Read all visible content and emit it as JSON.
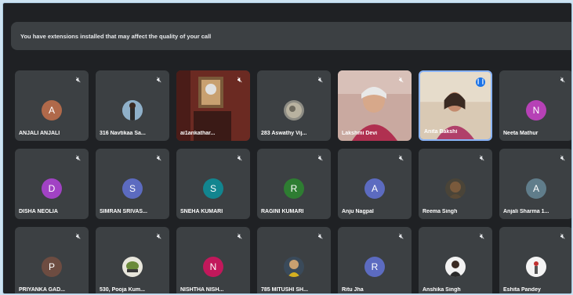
{
  "banner": {
    "text": "You have extensions installed that may affect the quality of your call"
  },
  "icons": {
    "mic_off": "mic-off-icon",
    "speaking": "speaking-indicator-icon"
  },
  "colors": {
    "speaking": "#1a73e8",
    "active_border": "#8ab4f8"
  },
  "participants": [
    {
      "name": "ANJALI ANJALI",
      "initial": "A",
      "color": "#b0694a"
    },
    {
      "name": "316 Navtikaa Sa...",
      "initial": "",
      "color": ""
    },
    {
      "name": "ai1ankathar...",
      "initial": "",
      "color": ""
    },
    {
      "name": "283 Aswathy Vij...",
      "initial": "",
      "color": ""
    },
    {
      "name": "Lakshmi Devi",
      "initial": "",
      "color": ""
    },
    {
      "name": "Anita Bakshi",
      "initial": "",
      "color": ""
    },
    {
      "name": "Neeta Mathur",
      "initial": "N",
      "color": "#b641b6"
    },
    {
      "name": "DISHA NEOLIA",
      "initial": "D",
      "color": "#a142c4"
    },
    {
      "name": "SIMRAN SRIVAS...",
      "initial": "S",
      "color": "#5c6bc0"
    },
    {
      "name": "SNEHA KUMARI",
      "initial": "S",
      "color": "#12858f"
    },
    {
      "name": "RAGINI KUMARI",
      "initial": "R",
      "color": "#2e7d32"
    },
    {
      "name": "Anju Nagpal",
      "initial": "A",
      "color": "#5c6bc0"
    },
    {
      "name": "Reema Singh",
      "initial": "",
      "color": ""
    },
    {
      "name": "Anjali Sharma 1...",
      "initial": "A",
      "color": "#607d8b"
    },
    {
      "name": "PRIYANKA GAD...",
      "initial": "P",
      "color": "#6d4c41"
    },
    {
      "name": "530, Pooja Kum...",
      "initial": "",
      "color": ""
    },
    {
      "name": "NISHTHA NISH...",
      "initial": "N",
      "color": "#c2185b"
    },
    {
      "name": "785 MITUSHI SH...",
      "initial": "",
      "color": ""
    },
    {
      "name": "Ritu Jha",
      "initial": "R",
      "color": "#5c6bc0"
    },
    {
      "name": "Anshika Singh",
      "initial": "",
      "color": ""
    },
    {
      "name": "Eshita Pandey",
      "initial": "",
      "color": ""
    }
  ]
}
